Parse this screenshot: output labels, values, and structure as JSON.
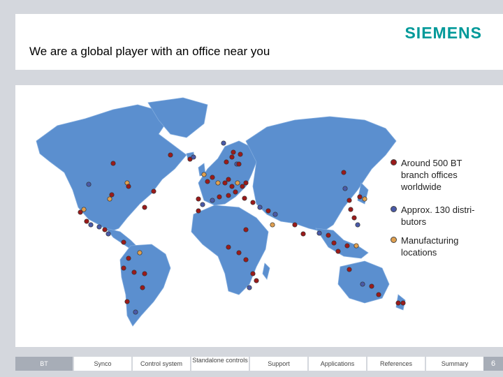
{
  "brand": {
    "logo_text": "SIEMENS",
    "logo_color": "#009999"
  },
  "header": {
    "title": "We are a global player with an office near you"
  },
  "map": {
    "land_color": "#5b8fcf",
    "ocean_color": "#ffffff"
  },
  "legend": [
    {
      "label": "Around 500 BT\nbranch offices\nworldwide",
      "color": "#9b1a1a"
    },
    {
      "label": "Approx. 130 distri-\nbutors",
      "color": "#4a5aa8"
    },
    {
      "label": "Manufacturing\nlocations",
      "color": "#e0a050"
    }
  ],
  "nav": {
    "tabs": [
      {
        "label": "BT",
        "active": true
      },
      {
        "label": "Synco"
      },
      {
        "label": "Control system"
      },
      {
        "label": "Standalone controls"
      },
      {
        "label": "Support"
      },
      {
        "label": "Applications"
      },
      {
        "label": "References"
      },
      {
        "label": "Summary"
      }
    ],
    "page_number": "6"
  }
}
